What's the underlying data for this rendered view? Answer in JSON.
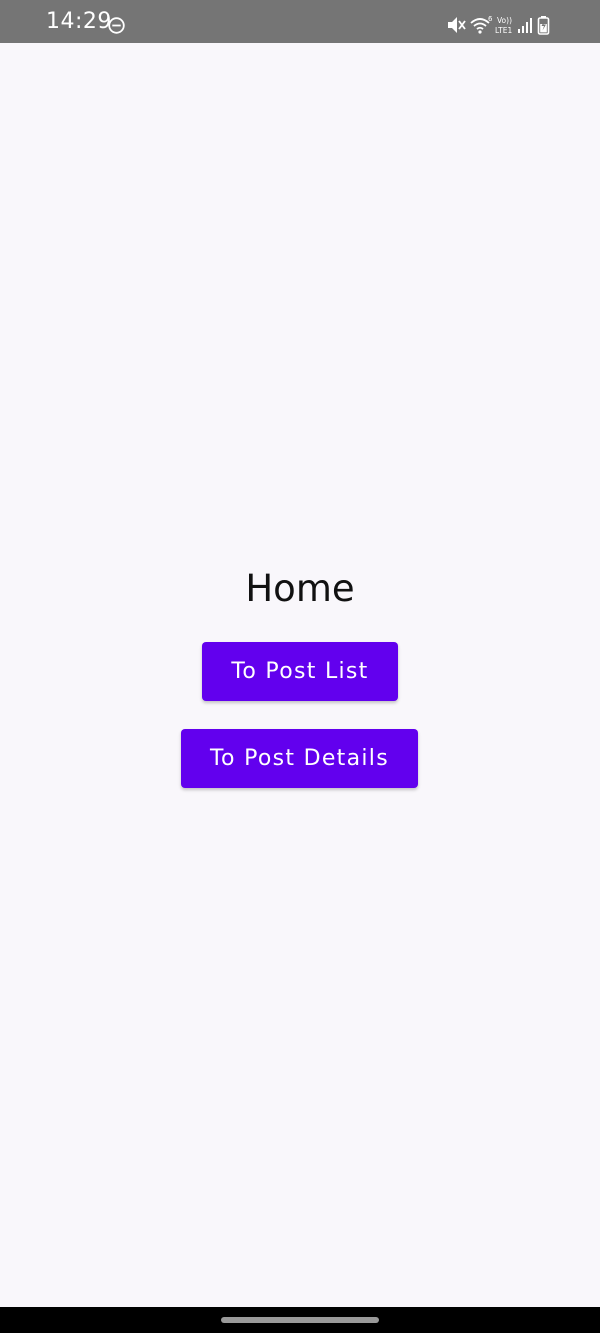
{
  "status_bar": {
    "time": "14:29",
    "icons": [
      "do-not-disturb-icon",
      "mute-icon",
      "wifi-icon",
      "volte-icon",
      "signal-icon",
      "battery-icon"
    ],
    "volte_label": "Vo))",
    "lte_label": "LTE1",
    "wifi_badge": "6"
  },
  "home": {
    "title": "Home",
    "buttons": {
      "post_list": "To Post List",
      "post_details": "To Post Details"
    }
  },
  "colors": {
    "accent": "#6200ee",
    "background": "#f9f7fb",
    "status_bar": "#757575"
  }
}
